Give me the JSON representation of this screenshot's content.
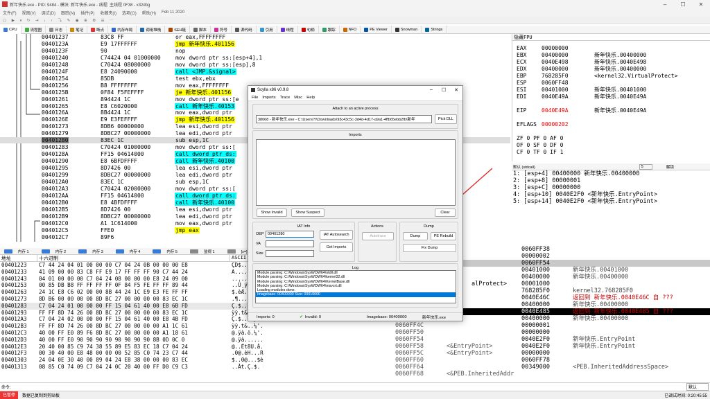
{
  "window": {
    "title": "新年快乐.exe - PID: 9484 - 模块: 新年快乐.exe - 线程: 主线程 0F38 - x32dbg"
  },
  "menu": [
    "文件(F)",
    "视图(V)",
    "调试(D)",
    "跟踪(N)",
    "插件(P)",
    "收藏夹(I)",
    "选项(O)",
    "帮助(H)",
    "Feb 11 2020"
  ],
  "tabs": [
    {
      "label": "CPU",
      "color": "#3a7bd5"
    },
    {
      "label": "流程图",
      "color": "#44aa44"
    },
    {
      "label": "日志",
      "color": "#888888"
    },
    {
      "label": "笔记",
      "color": "#cc8800"
    },
    {
      "label": "断点",
      "color": "#dd3333"
    },
    {
      "label": "内存布局",
      "color": "#3366cc"
    },
    {
      "label": "调用堆栈",
      "color": "#2266aa"
    },
    {
      "label": "SEH链",
      "color": "#aa4400"
    },
    {
      "label": "脚本",
      "color": "#666666"
    },
    {
      "label": "符号",
      "color": "#cc3399"
    },
    {
      "label": "源代码",
      "color": "#555555"
    },
    {
      "label": "引用",
      "color": "#3399cc"
    },
    {
      "label": "线程",
      "color": "#6633cc"
    },
    {
      "label": "句柄",
      "color": "#cc0000"
    },
    {
      "label": "跟踪",
      "color": "#339966"
    },
    {
      "label": "NFO",
      "color": "#cc6600"
    },
    {
      "label": "PE Viewer",
      "color": "#0055aa"
    },
    {
      "label": "Snowman",
      "color": "#333333"
    },
    {
      "label": "Strings",
      "color": "#006699"
    }
  ],
  "disasm": [
    {
      "addr": "00401237",
      "bytes": "83C8 FF",
      "ins": "or eax,FFFFFFFF",
      "hl": ""
    },
    {
      "addr": "0040123A",
      "bytes": "E9 17FFFFFF",
      "ins": "jmp 新年快乐.401156",
      "hl": "yellow"
    },
    {
      "addr": "0040123F",
      "bytes": "90",
      "ins": "nop",
      "hl": ""
    },
    {
      "addr": "00401240",
      "bytes": "C74424 04 01000000",
      "ins": "mov dword ptr ss:[esp+4],1",
      "hl": ""
    },
    {
      "addr": "00401248",
      "bytes": "C70424 08000000",
      "ins": "mov dword ptr ss:[esp],8",
      "hl": ""
    },
    {
      "addr": "0040124F",
      "bytes": "E8 24090000",
      "ins": "call <JMP.&signal>",
      "hl": "cyan"
    },
    {
      "addr": "00401254",
      "bytes": "85DB",
      "ins": "test ebx,ebx",
      "hl": ""
    },
    {
      "addr": "00401256",
      "bytes": "B8 FFFFFFFF",
      "ins": "mov eax,FFFFFFFF",
      "hl": ""
    },
    {
      "addr": "0040125B",
      "bytes": "0F84 F5FEFFFF",
      "ins": "je 新年快乐.401156",
      "hl": "yellow"
    },
    {
      "addr": "00401261",
      "bytes": "894424 1C",
      "ins": "mov dword ptr ss:[e",
      "hl": ""
    },
    {
      "addr": "00401265",
      "bytes": "E8 C6020000",
      "ins": "call 新年快乐.40153",
      "hl": "cyan"
    },
    {
      "addr": "0040126A",
      "bytes": "8B4424 1C",
      "ins": "mov eax,dword ptr",
      "hl": ""
    },
    {
      "addr": "0040126E",
      "bytes": "E9 E3FEFFFF",
      "ins": "jmp 新年快乐.401156",
      "hl": "yellow"
    },
    {
      "addr": "00401273",
      "bytes": "8DB6 00000000",
      "ins": "lea esi,dword ptr",
      "hl": ""
    },
    {
      "addr": "00401279",
      "bytes": "8DBC27 00000000",
      "ins": "lea edi,dword ptr",
      "hl": ""
    },
    {
      "addr": "00401280",
      "bytes": "83EC 1C",
      "ins": "sub esp,1C",
      "hl": "sel"
    },
    {
      "addr": "00401283",
      "bytes": "C70424 01000000",
      "ins": "mov dword ptr ss:[",
      "hl": ""
    },
    {
      "addr": "0040128A",
      "bytes": "FF15 04614000",
      "ins": "call dword ptr ds:",
      "hl": "cyan"
    },
    {
      "addr": "00401290",
      "bytes": "E8 6BFDFFFF",
      "ins": "call 新年快乐.40100",
      "hl": "cyan"
    },
    {
      "addr": "00401295",
      "bytes": "8D7426 00",
      "ins": "lea esi,dword ptr",
      "hl": ""
    },
    {
      "addr": "00401299",
      "bytes": "8DBC27 00000000",
      "ins": "lea edi,dword ptr",
      "hl": ""
    },
    {
      "addr": "004012A0",
      "bytes": "83EC 1C",
      "ins": "sub esp,1C",
      "hl": ""
    },
    {
      "addr": "004012A3",
      "bytes": "C70424 02000000",
      "ins": "mov dword ptr ss:[",
      "hl": ""
    },
    {
      "addr": "004012AA",
      "bytes": "FF15 04614000",
      "ins": "call dword ptr ds:",
      "hl": "cyan"
    },
    {
      "addr": "004012B0",
      "bytes": "E8 4BFDFFFF",
      "ins": "call 新年快乐.40100",
      "hl": "cyan"
    },
    {
      "addr": "004012B5",
      "bytes": "8D7426 00",
      "ins": "lea esi,dword ptr",
      "hl": ""
    },
    {
      "addr": "004012B9",
      "bytes": "8DBC27 00000000",
      "ins": "lea edi,dword ptr",
      "hl": ""
    },
    {
      "addr": "004012C0",
      "bytes": "A1 1C614000",
      "ins": "mov eax,dword ptr",
      "hl": ""
    },
    {
      "addr": "004012C5",
      "bytes": "FFE0",
      "ins": "jmp eax",
      "hl": "yellow"
    },
    {
      "addr": "004012C7",
      "bytes": "89F6",
      "ins": "",
      "hl": ""
    }
  ],
  "regs": {
    "header": "隐藏FPU",
    "lines": [
      {
        "n": "EAX",
        "v": "00000000",
        "c": ""
      },
      {
        "n": "EBX",
        "v": "00400000",
        "c": "新年快乐.00400000"
      },
      {
        "n": "ECX",
        "v": "0040E498",
        "c": "新年快乐.0040E498"
      },
      {
        "n": "EDX",
        "v": "00400000",
        "c": "新年快乐.00400000"
      },
      {
        "n": "EBP",
        "v": "768285F0",
        "c": "<kernel32.VirtualProtect>"
      },
      {
        "n": "ESP",
        "v": "0060FF48",
        "c": ""
      },
      {
        "n": "ESI",
        "v": "00401000",
        "c": "新年快乐.00401000"
      },
      {
        "n": "EDI",
        "v": "0040E49A",
        "c": "新年快乐.0040E49A"
      },
      {
        "n": "",
        "v": "",
        "c": ""
      },
      {
        "n": "EIP",
        "v": "0040E49A",
        "c": "新年快乐.0040E49A"
      },
      {
        "n": "",
        "v": "",
        "c": ""
      },
      {
        "n": "EFLAGS",
        "v": "00000202",
        "c": ""
      }
    ],
    "flags": [
      "ZF 0  PF 0  AF 0",
      "OF 0  SF 0  DF 0",
      "CF 0  TF 0  IF 1"
    ]
  },
  "stackhdr": {
    "conv": "默认 (stdcall)",
    "count": "5",
    "unlock": "解锁"
  },
  "stackargs": [
    "1: [esp+4] 00400000 新年快乐.00400000",
    "2: [esp+8] 00000001",
    "3: [esp+C] 00000000",
    "4: [esp+10] 0040E2F0 <新年快乐.EntryPoint>",
    "5: [esp+14] 0040E2F0 <新年快乐.EntryPoint>"
  ],
  "dumptabs": [
    "内存 1",
    "内存 2",
    "内存 3",
    "内存 4",
    "内存 5",
    "监视 1",
    "[x=] 局部变量",
    "结构体"
  ],
  "dumphdr": {
    "addr": "地址",
    "hex": "十六进制",
    "ascii": "ASCII"
  },
  "dump": [
    {
      "a": "00401223",
      "h": "C7 44 24 04 01 00 00 00 C7 04 24 0B 00 00 00 E8",
      "s": "ÇD$.....Ç.$....è"
    },
    {
      "a": "00401233",
      "h": "41 09 00 00 83 C8 FF E9 17 FF FF FF 90 C7 44 24",
      "s": "A....Èÿé.ÿÿÿ.ÇD$"
    },
    {
      "a": "00401243",
      "h": "04 01 00 00 00 C7 04 24 08 00 00 00 E8 24 09 00",
      "s": ".....Ç.$....è$.."
    },
    {
      "a": "00401253",
      "h": "00 85 DB B8 FF FF FF FF 0F 84 F5 FE FF FF 89 44",
      "s": "..Û¸ÿÿÿÿ..õþÿÿ.D"
    },
    {
      "a": "00401263",
      "h": "24 1C E8 C6 02 00 00 8B 44 24 1C E9 E3 FE FF FF",
      "s": "$.èÆ....D$.éãþÿÿ"
    },
    {
      "a": "00401273",
      "h": "8D B6 00 00 00 00 8D BC 27 00 00 00 00 83 EC 1C",
      "s": ".¶.....¼'......ì."
    },
    {
      "a": "00401283",
      "h": "C7 04 24 01 00 00 00 FF 15 04 61 40 00 E8 6B FD",
      "s": "Ç.$....ÿ..a@.èký"
    },
    {
      "a": "00401293",
      "h": "FF FF 8D 74 26 00 8D BC 27 00 00 00 00 83 EC 1C",
      "s": "ÿÿ.t&..¼'.....ì."
    },
    {
      "a": "004012A3",
      "h": "C7 04 24 02 00 00 00 FF 15 04 61 40 00 E8 4B FD",
      "s": "Ç.$....ÿ..a@.èKý"
    },
    {
      "a": "004012B3",
      "h": "FF FF 8D 74 26 00 8D BC 27 00 00 00 00 A1 1C 61",
      "s": "ÿÿ.t&..¼'....¡.a"
    },
    {
      "a": "004012C3",
      "h": "40 00 FF E0 89 F6 8D BC 27 00 00 00 00 A1 18 61",
      "s": "@.ÿà.ö.¼'....¡.a"
    },
    {
      "a": "004012D3",
      "h": "40 00 FF E0 90 90 90 90 90 90 90 90 8B 0D 0C 0",
      "s": "@.ÿà........."
    },
    {
      "a": "004012E3",
      "h": "20 40 00 85 C9 74 38 55 89 E5 83 EC 18 C7 04 24",
      "s": " @..Ét8U.å.ì.Ç.$"
    },
    {
      "a": "004012F3",
      "h": "00 30 40 00 E8 48 00 00 00 52 85 C0 74 23 C7 44",
      "s": ".0@.èH...R.Àt#ÇD"
    },
    {
      "a": "00401303",
      "h": "24 04 0E 30 40 00 89 04 24 E8 38 00 00 00 83 EC",
      "s": "$..0@...$è8....ì"
    },
    {
      "a": "00401313",
      "h": "08 85 C0 74 09 C7 04 24 0C 20 40 00 FF D0 C9 C3",
      "s": "..Àt.Ç.$. @.ÿÐÉÃ"
    }
  ],
  "stack2": [
    {
      "a": "0060FF38",
      "v": "",
      "c": ""
    },
    {
      "a": "00000002",
      "v": "",
      "c": ""
    },
    {
      "a": "0060FF54",
      "v": "",
      "c": ""
    },
    {
      "a": "00401000",
      "v": "",
      "c": "新年快乐.00401000"
    },
    {
      "a": "00400000",
      "v": "",
      "c": "新年快乐.00400000"
    },
    {
      "a": "00001000",
      "v": "alProtect>",
      "c": ""
    },
    {
      "a": "768285F0",
      "v": "",
      "c": "kernel32.768285F0"
    },
    {
      "a": "0040E46C",
      "v": "",
      "c": "返回到 新年快乐.0040E46C 自 ???"
    },
    {
      "a": "00400000",
      "v": "",
      "c": "新年快乐.00400000"
    },
    {
      "a": "0040E485",
      "v": "",
      "c": "返回到 新年快乐.0040E485 自 ???"
    },
    {
      "a": "00400000",
      "v": "",
      "c": "新年快乐.00400000"
    },
    {
      "a": "00000001",
      "v": "",
      "c": ""
    },
    {
      "a": "00000000",
      "v": "",
      "c": ""
    },
    {
      "a": "0040E2F0",
      "v": "",
      "c": "新年快乐.EntryPoint"
    },
    {
      "a": "0040E2F0",
      "v": "",
      "c": "新年快乐.EntryPoint"
    },
    {
      "a": "00000000",
      "v": "",
      "c": ""
    },
    {
      "a": "0060FF78",
      "v": "",
      "c": ""
    },
    {
      "a": "00349000",
      "v": "",
      "c": "<PEB.InheritedAddressSpace>"
    }
  ],
  "stack2left": [
    {
      "a": "0060FF4C",
      "t": ""
    },
    {
      "a": "0060FF50",
      "t": ""
    },
    {
      "a": "0060FF54",
      "t": ""
    },
    {
      "a": "0060FF58",
      "t": "<&EntryPoint>"
    },
    {
      "a": "0060FF5C",
      "t": "<&EntryPoint>"
    },
    {
      "a": "0060FF60",
      "t": ""
    },
    {
      "a": "0060FF64",
      "t": ""
    },
    {
      "a": "0060FF68",
      "t": "<&PEB.InheritedAddr"
    }
  ],
  "cmd": {
    "label": "命令:",
    "default": "默认"
  },
  "status": {
    "paused": "已暂停",
    "msg": "数据已复制到剪贴板",
    "time": "已调试时间: 0:20:45:55"
  },
  "scylla": {
    "title": "Scylla x86 v0.9.8",
    "menu": [
      "File",
      "Imports",
      "Trace",
      "Misc",
      "Help"
    ],
    "attach_label": "Attach to an active process",
    "process": "38068 - 新年快乐.exe - C:\\Users\\Y\\Downloads\\93c43c5c-3d4d-4d17-a9a1-4ffb65ebb2fb\\新年",
    "pick_dll": "Pick DLL",
    "imports_label": "Imports",
    "show_invalid": "Show Invalid",
    "show_suspect": "Show Suspect",
    "clear": "Clear",
    "iat_label": "IAT Info",
    "oep_lbl": "OEP",
    "oep": "00401280",
    "va_lbl": "VA",
    "va": "",
    "size_lbl": "Size",
    "size": "",
    "iat_auto": "IAT Autosearch",
    "get_imports": "Get Imports",
    "actions_label": "Actions",
    "autotrace": "Autotrace",
    "dump_label": "Dump",
    "dump": "Dump",
    "pe_rebuild": "PE Rebuild",
    "fix_dump": "Fix Dump",
    "log_label": "Log",
    "log": [
      "Module parsing: C:\\Windows\\SysWOW64\\ntdll.dll",
      "Module parsing: C:\\Windows\\SysWOW64\\kernel32.dll",
      "Module parsing: C:\\Windows\\SysWOW64\\KernelBase.dll",
      "Module parsing: C:\\Windows\\SysWOW64\\msvcrt.dll",
      "Loading modules done.",
      "Imagebase: 00400000 Size: 00010000"
    ],
    "st_imports": "Imports: 0",
    "st_invalid": "Invalid: 0",
    "st_imagebase": "Imagebase: 00400000",
    "st_module": "新年快乐.exe"
  }
}
